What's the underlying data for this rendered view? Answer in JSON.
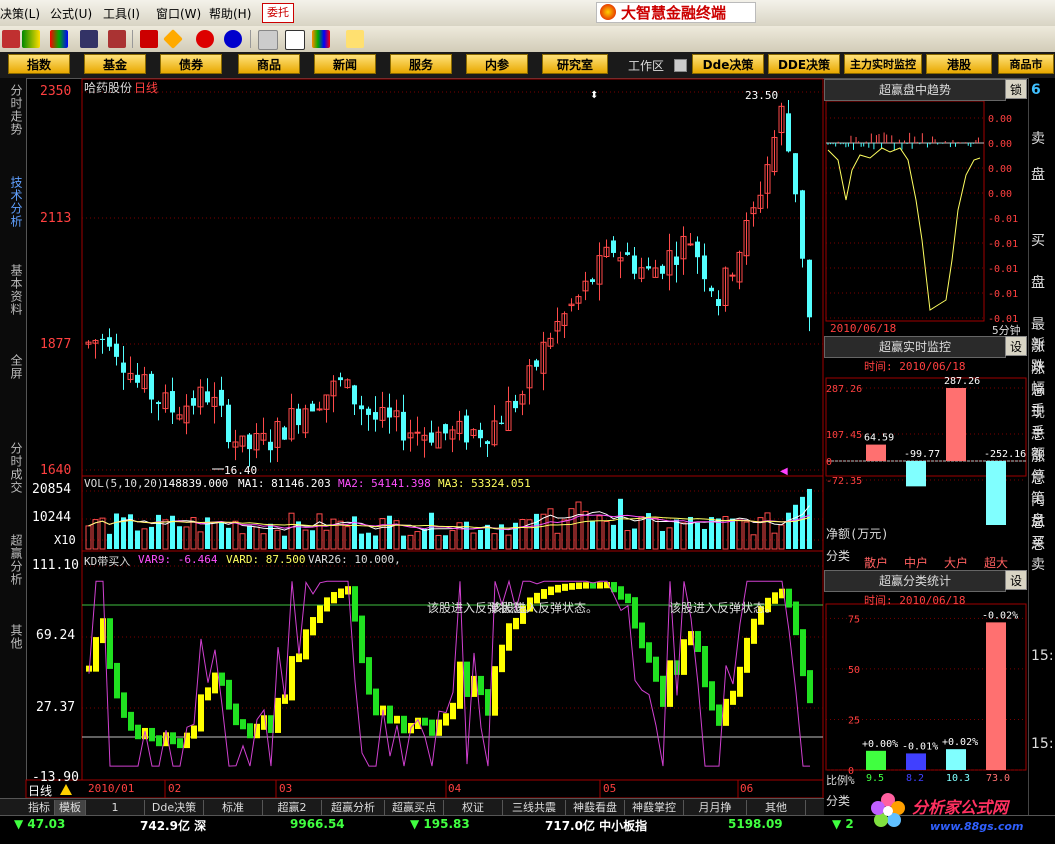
{
  "menubar": {
    "items": [
      "决策(L)",
      "公式(U)",
      "工具(I)",
      "窗口(W)",
      "帮助(H)"
    ],
    "entrust": "委托",
    "app_title": "大智慧金融终端"
  },
  "navbar": {
    "buttons": [
      "指数",
      "基金",
      "债券",
      "商品",
      "新闻",
      "服务",
      "内参",
      "研究室"
    ],
    "workzone": "工作区",
    "right_buttons": [
      "Dde决策",
      "DDE决策",
      "主力实时监控",
      "港股",
      "商品市"
    ]
  },
  "left_tabs": [
    "分时走势",
    "技术分析",
    "基本资料",
    "全屏",
    "分时成交",
    "超赢分析",
    "其他"
  ],
  "main_chart": {
    "stock_name": "哈药股份",
    "period": "日线",
    "y_labels": [
      "2350",
      "2113",
      "1877",
      "1640"
    ],
    "high_label": "23.50",
    "low_label": "16.40",
    "volume_header": "VOL(5,10,20)",
    "volume_value": "148839.000",
    "ma1": "MA1: 81146.203",
    "ma2": "MA2: 54141.398",
    "ma3": "MA3: 53324.051",
    "vol_labels": [
      "20854",
      "10244",
      "X10"
    ],
    "indicator_header": "KD带买入",
    "var9": "VAR9: -6.464",
    "vard": "VARD: 87.500",
    "var26": "VAR26: 10.000,",
    "indicator_labels": [
      "111.10",
      "69.24",
      "27.37",
      "-13.90"
    ],
    "annotation_1": "该股进入反弹状态。",
    "annotation_1b": "该股进入反弹状态。",
    "annotation_2": "该股进入反弹状态。",
    "x_labels": [
      "2010/01",
      "02",
      "03",
      "04",
      "05",
      "06"
    ],
    "period_tab": "日线"
  },
  "right_panel": {
    "trend_title": "超赢盘中趋势",
    "lock": "锁",
    "trend_date": "2010/06/18",
    "trend_period": "5分钟",
    "trend_ylabels": [
      "0.00",
      "0.00",
      "0.00",
      "0.00",
      "-0.01",
      "-0.01",
      "-0.01",
      "-0.01",
      "-0.01",
      "-0.01"
    ],
    "monitor_title": "超赢实时监控",
    "set": "设",
    "monitor_time": "时间: 2010/06/18",
    "monitor_ylabels": [
      "287.26",
      "107.45",
      "0",
      "-72.35"
    ],
    "monitor_bars": [
      {
        "label": "64.59",
        "value": 64.59,
        "color": "#ff7070"
      },
      {
        "label": "-99.77",
        "value": -99.77,
        "color": "#80ffff"
      },
      {
        "label": "287.26",
        "value": 287.26,
        "color": "#ff7070"
      },
      {
        "label": "-252.16",
        "value": -252.16,
        "color": "#80ffff"
      }
    ],
    "net_label": "净额(万元)",
    "category_label": "分类",
    "categories": [
      "散户",
      "中户",
      "大户",
      "超大"
    ],
    "stats_title": "超赢分类统计",
    "stats_time": "时间: 2010/06/18",
    "stats_ylabels": [
      "75",
      "50",
      "25",
      "0"
    ],
    "stats_bars": [
      {
        "pct": "+0.00%",
        "ratio": "9.5",
        "value": 9.5,
        "color": "#40ff40"
      },
      {
        "pct": "-0.01%",
        "ratio": "8.2",
        "value": 8.2,
        "color": "#4040ff"
      },
      {
        "pct": "+0.02%",
        "ratio": "10.3",
        "value": 10.3,
        "color": "#80ffff"
      },
      {
        "pct": "-0.02%",
        "ratio": "73.0",
        "value": 73.0,
        "color": "#ff7070"
      }
    ],
    "ratio_label": "比例%",
    "category_label_2": "分类"
  },
  "far_right": [
    "6",
    "卖",
    "盘",
    "买",
    "盘",
    "最新",
    "涨跌",
    "涨幅",
    "总手",
    "现手",
    "总额",
    "涨停",
    "总笔",
    "内盘",
    "总买",
    "总卖",
    "15:",
    "15:"
  ],
  "bottom_tabs": [
    "指标",
    "模板",
    "1",
    "Dde决策",
    "标准",
    "超赢2",
    "超赢分析",
    "超赢买点",
    "权证",
    "三线共震",
    "神鼗看盘",
    "神鼗掌控",
    "月月挣",
    "其他"
  ],
  "statusbar": {
    "items": [
      {
        "text": "▼ 47.03",
        "color": "#40ff40"
      },
      {
        "text": "742.9亿 深",
        "color": "#ffffff"
      },
      {
        "text": "9966.54",
        "color": "#40ff40"
      },
      {
        "text": "▼ 195.83",
        "color": "#40ff40"
      },
      {
        "text": "717.0亿 中小板指",
        "color": "#ffffff"
      },
      {
        "text": "5198.09",
        "color": "#40ff40"
      },
      {
        "text": "▼ 2",
        "color": "#40ff40"
      }
    ]
  },
  "watermark": {
    "text": "分析家公式网",
    "url": "www.88gs.com"
  }
}
